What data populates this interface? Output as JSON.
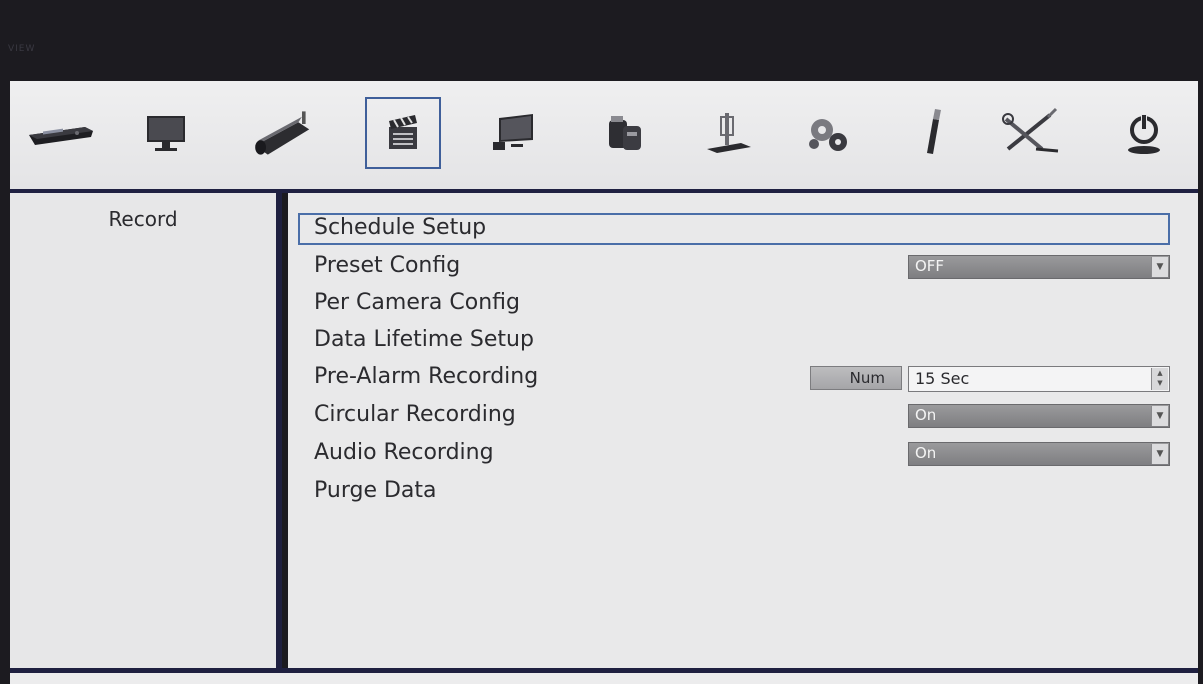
{
  "colors": {
    "background": "#1c1b20",
    "panel": "#e9e9ea",
    "divider": "#1f2040",
    "focus": "#4a6ea8",
    "dropdown": "#8b8b8e"
  },
  "toolbar": {
    "icons": [
      "dvr-device-icon",
      "monitor-icon",
      "camera-icon",
      "record-clapperboard-icon",
      "display-icon",
      "storage-icon",
      "network-icon",
      "gears-icon",
      "usb-icon",
      "tools-icon",
      "power-icon"
    ],
    "selected_index": 3
  },
  "left_panel": {
    "title": "Record"
  },
  "settings": {
    "schedule_setup": "Schedule Setup",
    "preset_config": {
      "label": "Preset Config",
      "value": "OFF"
    },
    "per_camera_config": "Per Camera Config",
    "data_lifetime_setup": "Data Lifetime Setup",
    "pre_alarm_recording": {
      "label": "Pre-Alarm Recording",
      "button": "Num",
      "value": "15 Sec"
    },
    "circular_recording": {
      "label": "Circular Recording",
      "value": "On"
    },
    "audio_recording": {
      "label": "Audio Recording",
      "value": "On"
    },
    "purge_data": "Purge Data"
  }
}
